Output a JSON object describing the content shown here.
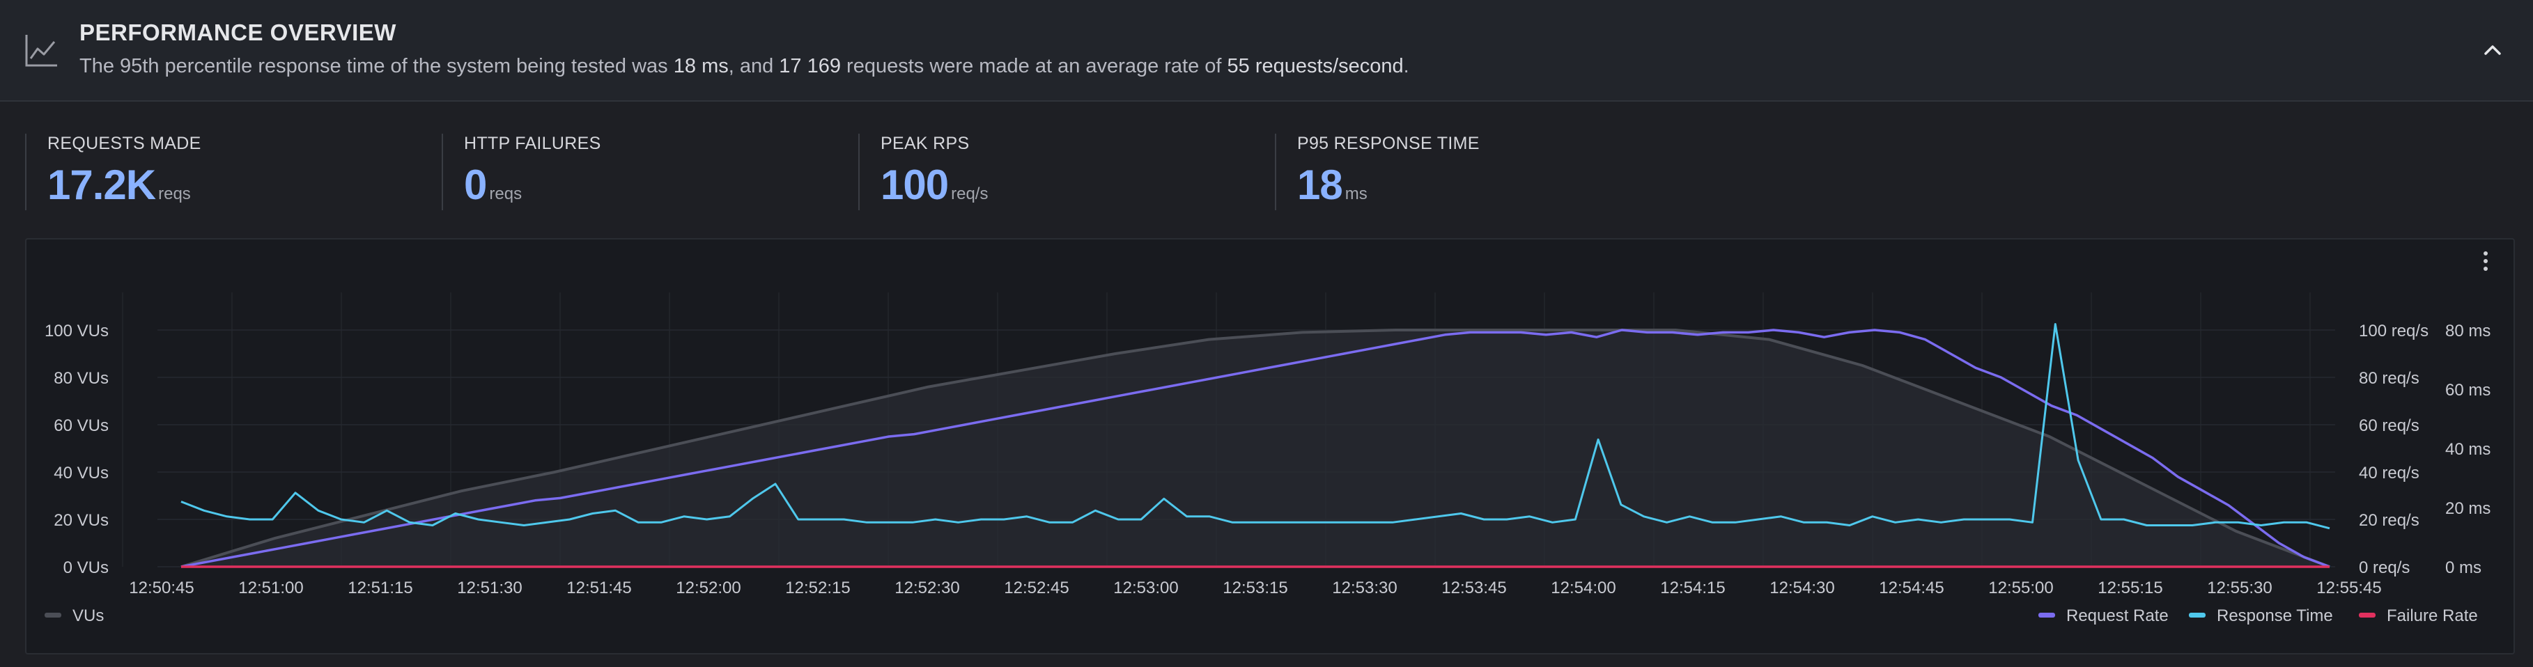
{
  "header": {
    "title": "PERFORMANCE OVERVIEW",
    "summary_prefix": "The 95th percentile response time of the system being tested was ",
    "summary_p95": "18 ms",
    "summary_mid": ", and ",
    "summary_requests": "17 169",
    "summary_mid2": " requests were made at an average rate of ",
    "summary_rate": "55 requests/second",
    "summary_suffix": "."
  },
  "stats": [
    {
      "label": "REQUESTS MADE",
      "value": "17.2K",
      "unit": "reqs"
    },
    {
      "label": "HTTP FAILURES",
      "value": "0",
      "unit": "reqs"
    },
    {
      "label": "PEAK RPS",
      "value": "100",
      "unit": "req/s"
    },
    {
      "label": "P95 RESPONSE TIME",
      "value": "18",
      "unit": "ms"
    }
  ],
  "colors": {
    "accent": "#8ab2ff",
    "vus": "#4b4e56",
    "request_rate": "#7b6cf0",
    "response_time": "#4fc8ec",
    "failure_rate": "#e0305e"
  },
  "chart_data": {
    "type": "line",
    "x_ticks": [
      "12:50:45",
      "12:51:00",
      "12:51:15",
      "12:51:30",
      "12:51:45",
      "12:52:00",
      "12:52:15",
      "12:52:30",
      "12:52:45",
      "12:53:00",
      "12:53:15",
      "12:53:30",
      "12:53:45",
      "12:54:00",
      "12:54:15",
      "12:54:30",
      "12:54:45",
      "12:55:00",
      "12:55:15",
      "12:55:30",
      "12:55:45"
    ],
    "x_range": [
      "12:50:45",
      "12:55:45"
    ],
    "y_left_ticks": [
      "0 VUs",
      "20 VUs",
      "40 VUs",
      "60 VUs",
      "80 VUs",
      "100 VUs"
    ],
    "y_left_range": [
      0,
      110
    ],
    "y_right1_ticks": [
      "0 req/s",
      "20 req/s",
      "40 req/s",
      "60 req/s",
      "80 req/s",
      "100 req/s"
    ],
    "y_right1_range": [
      0,
      110
    ],
    "y_right2_ticks": [
      "0 ms",
      "20 ms",
      "40 ms",
      "60 ms",
      "80 ms"
    ],
    "y_right2_range": [
      0,
      88
    ],
    "grid": true,
    "legend": "bottom",
    "series": [
      {
        "name": "VUs",
        "axis": "left",
        "x_seconds": [
          0,
          25,
          50,
          75,
          100,
          125,
          150,
          175,
          200,
          210,
          220,
          235,
          245,
          255,
          265,
          270,
          280,
          290,
          295,
          300
        ],
        "values": [
          0,
          12,
          22,
          32,
          40,
          49,
          58,
          67,
          76,
          83,
          90,
          96,
          99,
          100,
          100,
          100,
          100,
          96,
          85,
          70,
          55,
          35,
          15,
          0
        ]
      },
      {
        "name": "Request Rate",
        "axis": "right1",
        "values": [
          0,
          2,
          4,
          6,
          8,
          10,
          12,
          14,
          16,
          18,
          20,
          22,
          24,
          26,
          28,
          29,
          31,
          33,
          35,
          37,
          39,
          41,
          43,
          45,
          47,
          49,
          51,
          53,
          55,
          56,
          58,
          60,
          62,
          64,
          66,
          68,
          70,
          72,
          74,
          76,
          78,
          80,
          82,
          84,
          86,
          88,
          90,
          92,
          94,
          96,
          98,
          99,
          99,
          99,
          98,
          99,
          97,
          100,
          99,
          99,
          98,
          99,
          99,
          100,
          99,
          97,
          99,
          100,
          99,
          96,
          90,
          84,
          80,
          74,
          68,
          64,
          58,
          52,
          46,
          38,
          32,
          26,
          18,
          10,
          4,
          0
        ]
      },
      {
        "name": "Response Time",
        "axis": "right2",
        "values": [
          22,
          19,
          17,
          16,
          16,
          25,
          19,
          16,
          15,
          19,
          15,
          14,
          18,
          16,
          15,
          14,
          15,
          16,
          18,
          19,
          15,
          15,
          17,
          16,
          17,
          23,
          28,
          16,
          16,
          16,
          15,
          15,
          15,
          16,
          15,
          16,
          16,
          17,
          15,
          15,
          19,
          16,
          16,
          23,
          17,
          17,
          15,
          15,
          15,
          15,
          15,
          15,
          15,
          15,
          16,
          17,
          18,
          16,
          16,
          17,
          15,
          16,
          43,
          21,
          17,
          15,
          17,
          15,
          15,
          16,
          17,
          15,
          15,
          14,
          17,
          15,
          16,
          15,
          16,
          16,
          16,
          15,
          82,
          36,
          16,
          16,
          14,
          14,
          14,
          15,
          15,
          14,
          15,
          15,
          13
        ]
      },
      {
        "name": "Failure Rate",
        "axis": "right1",
        "values": [
          0,
          0
        ]
      }
    ]
  }
}
